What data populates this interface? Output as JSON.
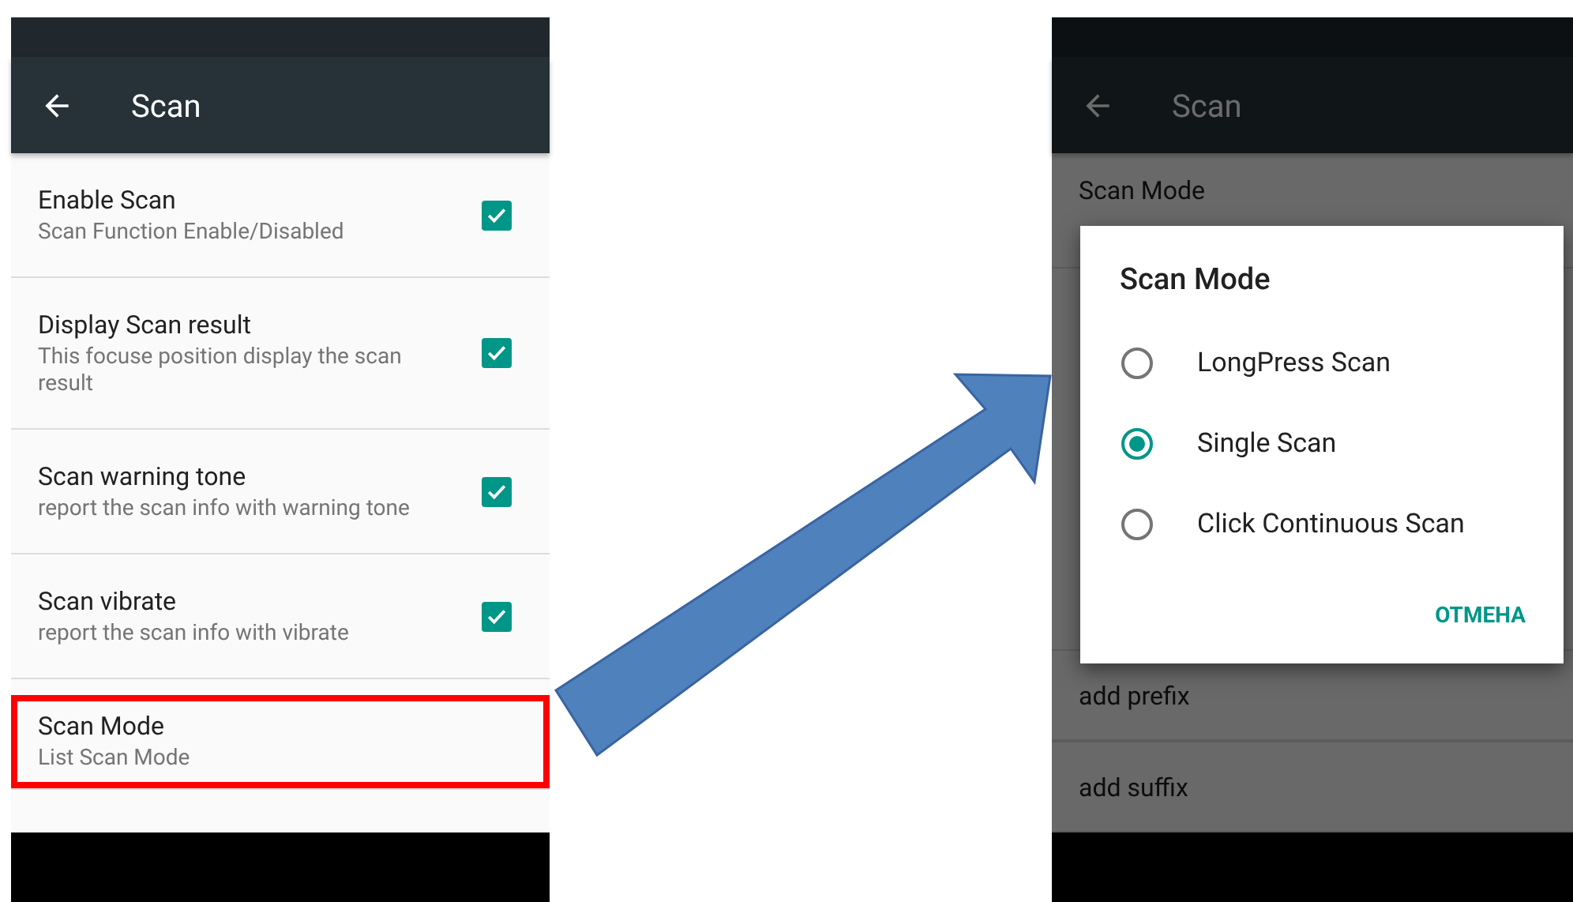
{
  "left_screen": {
    "toolbar": {
      "title": "Scan"
    },
    "settings": [
      {
        "kind": "checkbox",
        "title": "Enable Scan",
        "summary": "Scan Function Enable/Disabled",
        "checked": true,
        "highlighted": false
      },
      {
        "kind": "checkbox",
        "title": "Display Scan result",
        "summary": "This focuse position display the scan result",
        "checked": true,
        "highlighted": false
      },
      {
        "kind": "checkbox",
        "title": "Scan warning tone",
        "summary": "report the scan info with warning tone",
        "checked": true,
        "highlighted": false
      },
      {
        "kind": "checkbox",
        "title": "Scan vibrate",
        "summary": "report the scan info with vibrate",
        "checked": true,
        "highlighted": false
      },
      {
        "kind": "list",
        "title": "Scan Mode",
        "summary": "List Scan Mode",
        "highlighted": true
      }
    ]
  },
  "right_screen": {
    "toolbar": {
      "title": "Scan"
    },
    "settings": [
      {
        "title": "Scan Mode"
      },
      {
        "title": "add prefix"
      },
      {
        "title": "add suffix"
      }
    ],
    "dialog": {
      "title": "Scan Mode",
      "options": [
        {
          "label": "LongPress Scan",
          "selected": false
        },
        {
          "label": "Single Scan",
          "selected": true
        },
        {
          "label": "Click Continuous Scan",
          "selected": false
        }
      ],
      "buttons": [
        "ОТМЕНА"
      ]
    }
  }
}
